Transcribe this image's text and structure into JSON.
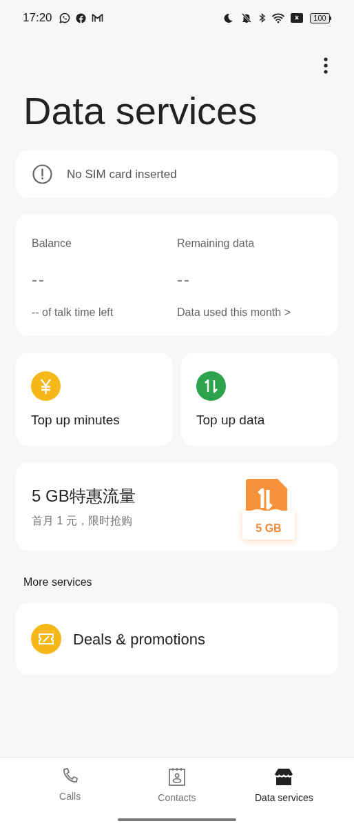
{
  "status_bar": {
    "time": "17:20",
    "battery": "100"
  },
  "title": "Data services",
  "sim_notice": "No SIM card inserted",
  "summary": [
    {
      "label": "Balance",
      "value": "--",
      "footer": "-- of talk time left"
    },
    {
      "label": "Remaining data",
      "value": "--",
      "footer": "Data used this month >"
    }
  ],
  "tiles": [
    {
      "kind": "yuan",
      "label": "Top up minutes"
    },
    {
      "kind": "data",
      "label": "Top up data"
    }
  ],
  "promo": {
    "title": "5 GB特惠流量",
    "subtitle": "首月 1 元，限时抢购",
    "badge": "5 GB"
  },
  "section_title": "More services",
  "services": [
    {
      "label": "Deals & promotions"
    }
  ],
  "nav": [
    {
      "kind": "phone",
      "label": "Calls",
      "selected": false
    },
    {
      "kind": "contacts",
      "label": "Contacts",
      "selected": false
    },
    {
      "kind": "store",
      "label": "Data services",
      "selected": true
    }
  ]
}
